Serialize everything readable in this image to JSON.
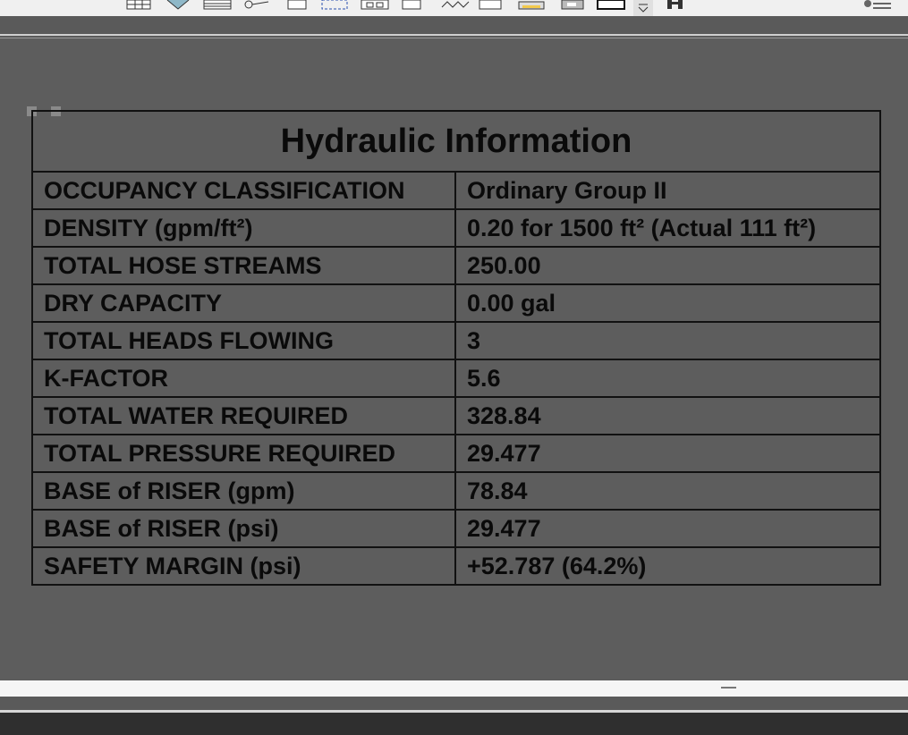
{
  "toolbar": {
    "icons": [
      "table-grid-icon",
      "pencil-icon",
      "spreadsheet-icon",
      "link-tool-icon",
      "window-icon",
      "select-dashed-icon",
      "panel-icon",
      "square-icon",
      "waveform-icon",
      "blank-window-icon",
      "printer-icon",
      "frame-icon",
      "filled-box-icon",
      "overflow-icon",
      "riser-icon",
      "list-icon"
    ]
  },
  "table": {
    "title": "Hydraulic Information",
    "rows": [
      {
        "label": "OCCUPANCY CLASSIFICATION",
        "value": "Ordinary Group II"
      },
      {
        "label": "DENSITY (gpm/ft²)",
        "value": "0.20 for 1500 ft² (Actual 111 ft²)"
      },
      {
        "label": "TOTAL HOSE STREAMS",
        "value": "250.00"
      },
      {
        "label": "DRY CAPACITY",
        "value": "0.00 gal"
      },
      {
        "label": "TOTAL HEADS FLOWING",
        "value": "3"
      },
      {
        "label": "K-FACTOR",
        "value": "5.6"
      },
      {
        "label": "TOTAL WATER REQUIRED",
        "value": "328.84"
      },
      {
        "label": "TOTAL PRESSURE REQUIRED",
        "value": "29.477"
      },
      {
        "label": "BASE of RISER (gpm)",
        "value": "78.84"
      },
      {
        "label": "BASE of RISER (psi)",
        "value": "29.477"
      },
      {
        "label": "SAFETY MARGIN (psi)",
        "value": "+52.787 (64.2%)"
      }
    ]
  }
}
